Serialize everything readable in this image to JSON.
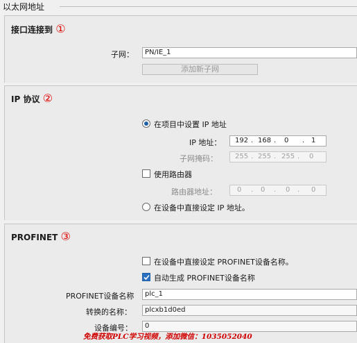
{
  "header": {
    "title": "以太网地址"
  },
  "section1": {
    "heading": "接口连接到",
    "marker": "①",
    "subnet_label": "子网：",
    "subnet_value": "PN/IE_1",
    "add_subnet_button": "添加新子网"
  },
  "section2": {
    "heading": "IP 协议",
    "marker": "②",
    "radio_project_label": "在项目中设置 IP 地址",
    "radio_project_selected": true,
    "ip_label": "IP 地址：",
    "ip": [
      "192",
      "168",
      "0",
      "1"
    ],
    "mask_label": "子网掩码：",
    "mask": [
      "255",
      "255",
      "255",
      "0"
    ],
    "router_checkbox_label": "使用路由器",
    "router_checked": false,
    "router_addr_label": "路由器地址：",
    "router": [
      "0",
      "0",
      "0",
      "0"
    ],
    "radio_device_label": "在设备中直接设定 IP 地址。",
    "radio_device_selected": false
  },
  "section3": {
    "heading": "PROFINET",
    "marker": "③",
    "set_name_in_device_label": "在设备中直接设定 PROFINET设备名称。",
    "set_name_in_device_checked": false,
    "auto_name_label": "自动生成 PROFINET设备名称",
    "auto_name_checked": true,
    "device_name_label": "PROFINET设备名称",
    "device_name_value": "plc_1",
    "converted_name_label": "转换的名称：",
    "converted_name_value": "plcxb1d0ed",
    "device_number_label": "设备编号：",
    "device_number_value": "0"
  },
  "watermark": "免费获取PLC学习视频，添加微信：1035052040",
  "colors": {
    "accent": "#1f5fa8",
    "marker_red": "#e00000",
    "panel": "#ebebeb"
  }
}
